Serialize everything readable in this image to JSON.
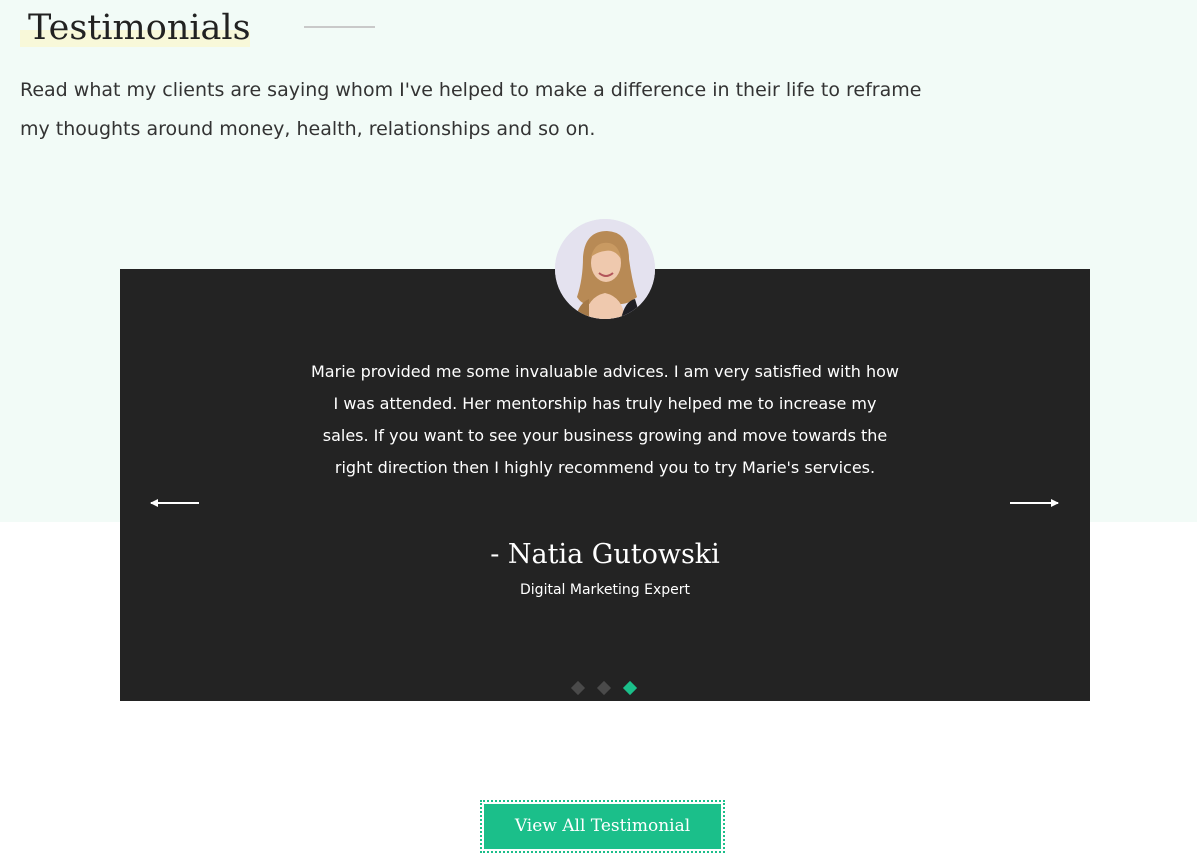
{
  "section": {
    "title": "Testimonials",
    "intro": "Read what my clients are saying whom I've helped to make a difference in their life to reframe my thoughts around money, health, relationships and so on."
  },
  "testimonial": {
    "quote": "Marie provided me some invaluable advices. I am very satisfied with how I was attended. Her mentorship has truly helped me to increase my sales. If you want to see your business growing and move towards the right direction then I highly recommend you to try Marie's services.",
    "author": "- Natia Gutowski",
    "role": "Digital Marketing Expert",
    "avatar_icon": "client-portrait",
    "slide_count": 3,
    "active_slide": 3
  },
  "slider": {
    "prev_icon": "arrow-left-icon",
    "next_icon": "arrow-right-icon"
  },
  "cta": {
    "label": "View All Testimonial"
  },
  "colors": {
    "background_band": "#f2fbf7",
    "card": "#232323",
    "accent": "#1bbf8a",
    "title_highlight": "#f8f8d9",
    "inactive_dot": "#4a4a4a"
  }
}
